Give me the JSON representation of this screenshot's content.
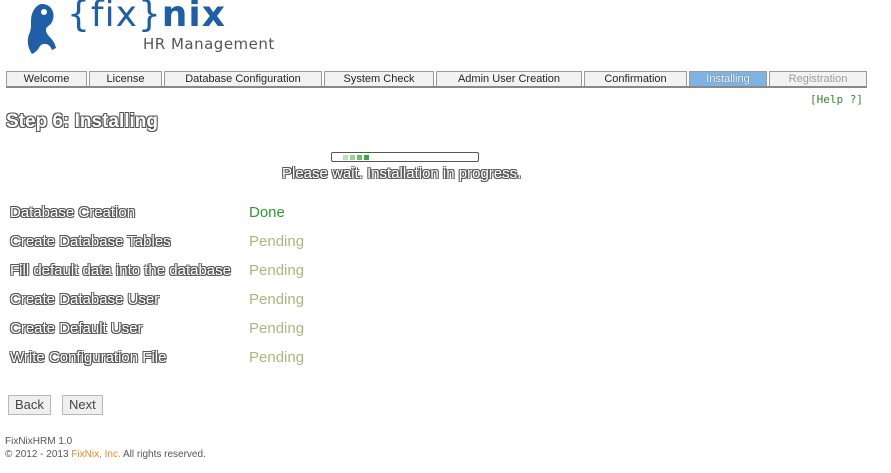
{
  "logo": {
    "word_left": "{fix}",
    "word_right": "nix",
    "subtitle": "HR Management"
  },
  "tabs": [
    {
      "label": "Welcome",
      "state": "normal"
    },
    {
      "label": "License",
      "state": "normal"
    },
    {
      "label": "Database Configuration",
      "state": "normal"
    },
    {
      "label": "System Check",
      "state": "normal"
    },
    {
      "label": "Admin User Creation",
      "state": "normal"
    },
    {
      "label": "Confirmation",
      "state": "normal"
    },
    {
      "label": "Installing",
      "state": "active"
    },
    {
      "label": "Registration",
      "state": "disabled"
    }
  ],
  "help_link": "[Help ?]",
  "page_title": "Step 6: Installing",
  "progress": {
    "message": "Please wait. Installation in progress."
  },
  "steps": [
    {
      "name": "Database Creation",
      "status": "Done"
    },
    {
      "name": "Create Database Tables",
      "status": "Pending"
    },
    {
      "name": "Fill default data into the database",
      "status": "Pending"
    },
    {
      "name": "Create Database User",
      "status": "Pending"
    },
    {
      "name": "Create Default User",
      "status": "Pending"
    },
    {
      "name": "Write Configuration File",
      "status": "Pending"
    }
  ],
  "buttons": {
    "back": "Back",
    "next": "Next"
  },
  "footer": {
    "version": "FixNixHRM 1.0",
    "copyright_prefix": "© 2012 - 2013",
    "company": "FixNix, Inc.",
    "rights": "All rights reserved."
  },
  "colors": {
    "brand_blue": "#1f5fa8",
    "done": "#2e9a2e",
    "pending": "#a9b87a",
    "active_tab": "#7fb4e2",
    "footer_brand": "#e08a2c"
  }
}
